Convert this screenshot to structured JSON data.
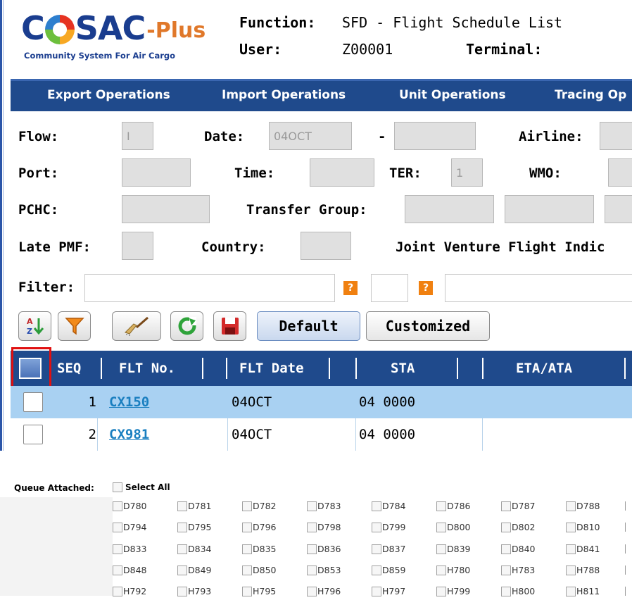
{
  "header": {
    "logo_main": "COSAC",
    "logo_plus": "-Plus",
    "logo_tagline": "Community System For Air Cargo",
    "function_label": "Function:",
    "function_value": "SFD - Flight Schedule List",
    "user_label": "User:",
    "user_value": "Z00001",
    "terminal_label": "Terminal:"
  },
  "nav": {
    "items": [
      "Export Operations",
      "Import Operations",
      "Unit Operations",
      "Tracing Op"
    ]
  },
  "form": {
    "flow_label": "Flow:",
    "flow_value": "I",
    "date_label": "Date:",
    "date_value": "04OCT",
    "date_sep": "-",
    "airline_label": "Airline:",
    "port_label": "Port:",
    "time_label": "Time:",
    "ter_label": "TER:",
    "ter_value": "1",
    "wmo_label": "WMO:",
    "pchc_label": "PCHC:",
    "transfer_group_label": "Transfer Group:",
    "late_pmf_label": "Late PMF:",
    "country_label": "Country:",
    "joint_venture_label": "Joint Venture Flight Indic",
    "filter_label": "Filter:",
    "help_glyph": "?"
  },
  "toolbar": {
    "default_label": "Default",
    "customized_label": "Customized"
  },
  "grid": {
    "columns": [
      "SEQ",
      "FLT No.",
      "FLT Date",
      "STA",
      "ETA/ATA"
    ],
    "rows": [
      {
        "seq": "1",
        "flt_no": "CX150",
        "flt_date": "04OCT",
        "sta": "04 0000",
        "eta_ata": ""
      },
      {
        "seq": "2",
        "flt_no": "CX981",
        "flt_date": "04OCT",
        "sta": "04 0000",
        "eta_ata": ""
      }
    ]
  },
  "queue": {
    "label": "Queue Attached:",
    "select_all": "Select All",
    "rows": [
      [
        "D780",
        "D781",
        "D782",
        "D783",
        "D784",
        "D786",
        "D787",
        "D788"
      ],
      [
        "D794",
        "D795",
        "D796",
        "D798",
        "D799",
        "D800",
        "D802",
        "D810"
      ],
      [
        "D833",
        "D834",
        "D835",
        "D836",
        "D837",
        "D839",
        "D840",
        "D841"
      ],
      [
        "D848",
        "D849",
        "D850",
        "D853",
        "D859",
        "H780",
        "H783",
        "H788"
      ],
      [
        "H792",
        "H793",
        "H795",
        "H796",
        "H797",
        "H799",
        "H800",
        "H811"
      ]
    ]
  },
  "colors": {
    "nav_bg": "#1f4a8c",
    "selected_row_bg": "#a9d1f2",
    "link": "#1a7fc0",
    "highlight_border": "#e01010",
    "help_button": "#f08010"
  }
}
